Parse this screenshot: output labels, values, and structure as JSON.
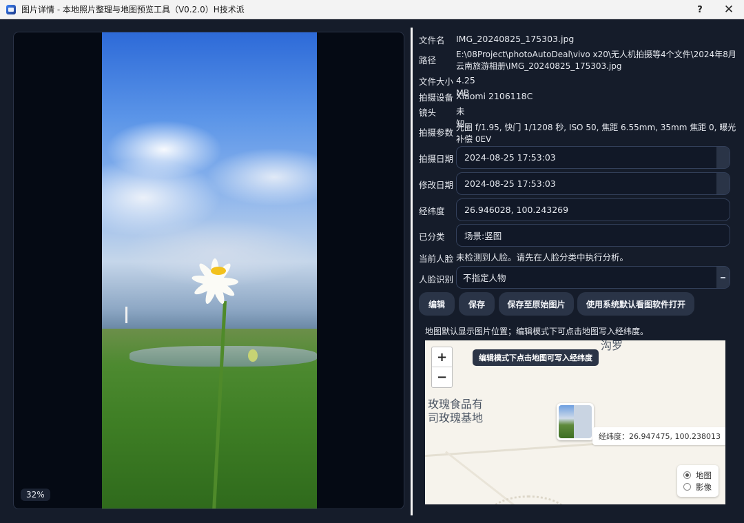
{
  "window": {
    "title": "图片详情 - 本地照片整理与地图预览工具（V0.2.0）H技术派",
    "help_label": "?",
    "close_label": "✕"
  },
  "image_panel": {
    "zoom": "32%"
  },
  "details": {
    "filename_label": "文件名",
    "filename": "IMG_20240825_175303.jpg",
    "path_label": "路径",
    "path_line1": "E:\\08Project\\photoAutoDeal\\vivo x20\\无人机拍摄等4个文件\\2024年8月",
    "path_line2": "云南旅游相册\\IMG_20240825_175303.jpg",
    "size_label": "文件大小",
    "size": "4.25 MB",
    "device_label": "拍摄设备",
    "device": "Xiaomi 2106118C",
    "lens_label": "镜头",
    "lens": "未知",
    "params_label": "拍摄参数",
    "params_line1": "光圈 f/1.95, 快门 1/1208 秒, ISO 50, 焦距 6.55mm, 35mm 焦距 0, 曝光",
    "params_line2": "补偿 0EV",
    "shot_date_label": "拍摄日期",
    "shot_date": "2024-08-25 17:53:03",
    "modified_date_label": "修改日期",
    "modified_date": "2024-08-25 17:53:03",
    "latlng_label": "经纬度",
    "latlng": "26.946028, 100.243269",
    "category_label": "已分类",
    "category": "场景:竖图",
    "face_label": "当前人脸",
    "face": "未检测到人脸。请先在人脸分类中执行分析。",
    "face_id_label": "人脸识别",
    "face_id": "不指定人物"
  },
  "buttons": {
    "edit": "编辑",
    "save": "保存",
    "save_original": "保存至原始图片",
    "open_default": "使用系统默认看图软件打开"
  },
  "map": {
    "note": "地图默认显示图片位置；编辑模式下可点击地图写入经纬度。",
    "zoom_in": "+",
    "zoom_out": "−",
    "tip": "编辑模式下点击地图可写入经纬度",
    "label_top": "沟罗",
    "label_poi1": "玫瑰食品有",
    "label_poi2": "司玫瑰基地",
    "coord_popup": "经纬度：26.947475, 100.238013",
    "layer_map": "地图",
    "layer_image": "影像",
    "selected_layer": "地图"
  }
}
